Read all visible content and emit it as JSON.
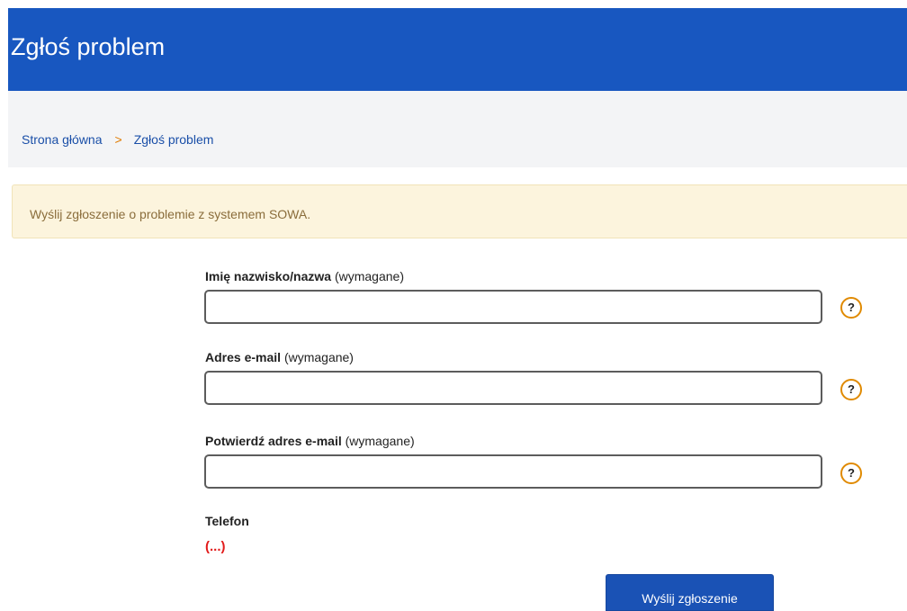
{
  "header": {
    "title": "Zgłoś problem"
  },
  "breadcrumb": {
    "home": "Strona główna",
    "separator": ">",
    "current": "Zgłoś problem"
  },
  "notice": {
    "text": "Wyślij zgłoszenie o problemie z systemem SOWA."
  },
  "form": {
    "name": {
      "label": "Imię nazwisko/nazwa",
      "required_note": "(wymagane)",
      "value": "",
      "help_icon": "question-circle-icon",
      "help_glyph": "?"
    },
    "email": {
      "label": "Adres e-mail",
      "required_note": "(wymagane)",
      "value": "",
      "help_icon": "question-circle-icon",
      "help_glyph": "?"
    },
    "email_confirm": {
      "label": "Potwierdź adres e-mail",
      "required_note": "(wymagane)",
      "value": "",
      "help_icon": "question-circle-icon",
      "help_glyph": "?"
    },
    "phone": {
      "label": "Telefon",
      "ellipsis": "(...)"
    },
    "submit_label": "Wyślij zgłoszenie"
  },
  "colors": {
    "header_bg": "#1857c0",
    "breadcrumb_bg": "#f3f4f6",
    "link": "#1a4fa8",
    "separator": "#e07b00",
    "notice_bg": "#fcf4dd",
    "notice_text": "#8a6d3b",
    "help_icon_border": "#e08a00",
    "ellipsis": "#e21b1b",
    "button_bg": "#1a52b5"
  }
}
